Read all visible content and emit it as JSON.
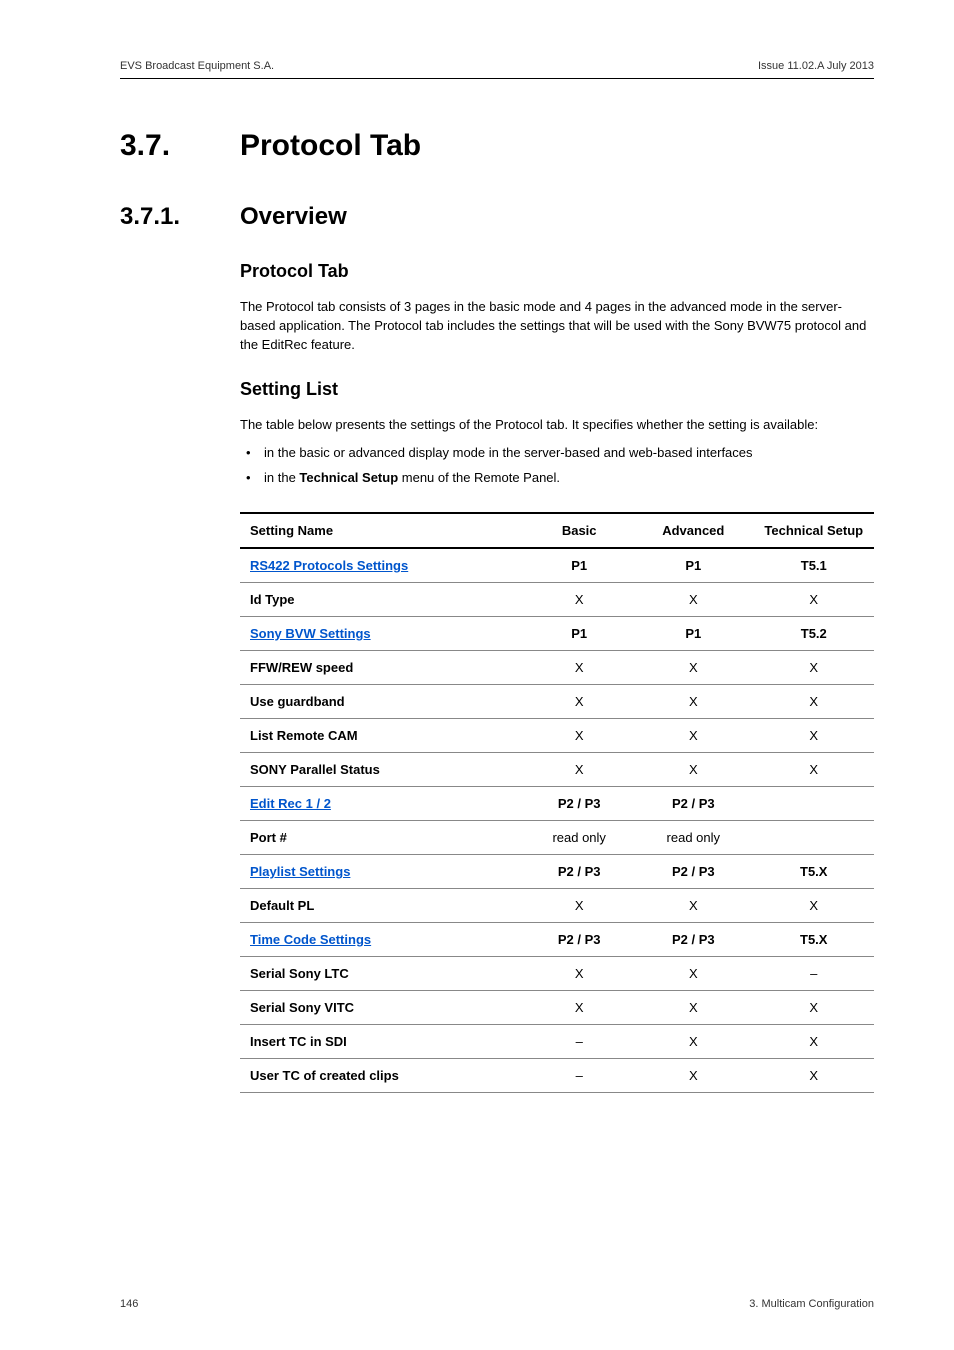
{
  "header": {
    "left": "EVS Broadcast Equipment S.A.",
    "right": "Issue 11.02.A  July 2013"
  },
  "h1": {
    "num": "3.7.",
    "title": "Protocol Tab"
  },
  "h2": {
    "num": "3.7.1.",
    "title": "Overview"
  },
  "sub1": {
    "heading": "Protocol Tab",
    "para": "The Protocol tab consists of 3 pages in the basic mode and 4 pages in the advanced mode in the server-based application. The Protocol tab includes the settings that will be used with the Sony BVW75 protocol and the EditRec feature."
  },
  "sub2": {
    "heading": "Setting List",
    "para": "The table below presents the settings of the Protocol tab. It specifies whether the setting is available:",
    "bullets": [
      "in the basic or advanced display mode in the server-based and web-based interfaces",
      "in the Technical Setup menu of the Remote Panel."
    ],
    "bullet_bold_phrase": "Technical Setup"
  },
  "table": {
    "headers": [
      "Setting Name",
      "Basic",
      "Advanced",
      "Technical Setup"
    ],
    "rows": [
      {
        "name": "RS422 Protocols Settings",
        "link": true,
        "basic": "P1",
        "adv": "P1",
        "tech": "T5.1",
        "section": true
      },
      {
        "name": "Id Type",
        "basic": "X",
        "adv": "X",
        "tech": "X"
      },
      {
        "name": "Sony BVW Settings",
        "link": true,
        "basic": "P1",
        "adv": "P1",
        "tech": "T5.2",
        "section": true
      },
      {
        "name": "FFW/REW speed",
        "basic": "X",
        "adv": "X",
        "tech": "X"
      },
      {
        "name": "Use guardband",
        "basic": "X",
        "adv": "X",
        "tech": "X"
      },
      {
        "name": "List Remote CAM",
        "basic": "X",
        "adv": "X",
        "tech": "X"
      },
      {
        "name": "SONY Parallel Status",
        "basic": "X",
        "adv": "X",
        "tech": "X"
      },
      {
        "name": "Edit Rec 1 / 2",
        "link": true,
        "basic": "P2 / P3",
        "adv": "P2 / P3",
        "tech": "",
        "section": true
      },
      {
        "name": "Port #",
        "basic": "read only",
        "adv": "read only",
        "tech": ""
      },
      {
        "name": "Playlist Settings",
        "link": true,
        "basic": "P2 / P3",
        "adv": "P2 / P3",
        "tech": "T5.X",
        "section": true
      },
      {
        "name": "Default PL",
        "basic": "X",
        "adv": "X",
        "tech": "X"
      },
      {
        "name": "Time Code Settings",
        "link": true,
        "basic": "P2 / P3",
        "adv": "P2 / P3",
        "tech": "T5.X",
        "section": true
      },
      {
        "name": "Serial Sony LTC",
        "basic": "X",
        "adv": "X",
        "tech": "–"
      },
      {
        "name": "Serial Sony VITC",
        "basic": "X",
        "adv": "X",
        "tech": "X"
      },
      {
        "name": "Insert TC in SDI",
        "basic": "–",
        "adv": "X",
        "tech": "X"
      },
      {
        "name": "User TC of created clips",
        "basic": "–",
        "adv": "X",
        "tech": "X"
      }
    ]
  },
  "footer": {
    "left": "146",
    "right": "3. Multicam Configuration"
  }
}
